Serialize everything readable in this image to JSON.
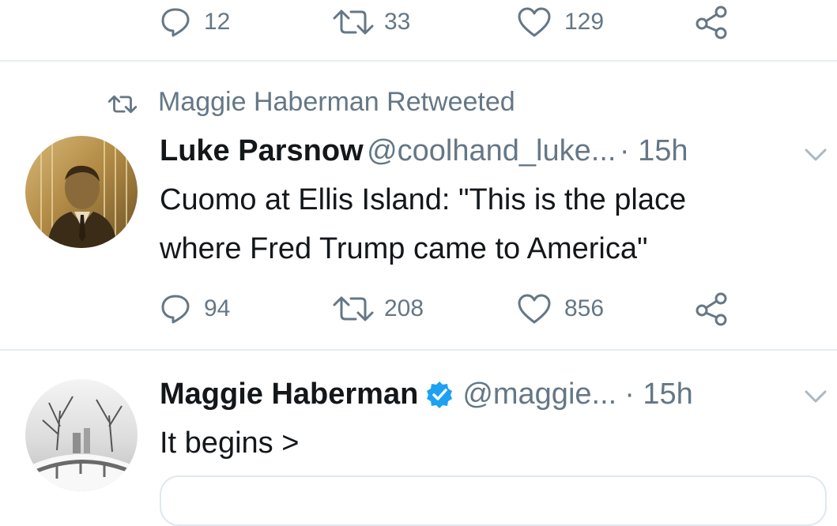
{
  "top_tweet": {
    "actions": {
      "replies": "12",
      "retweets": "33",
      "likes": "129"
    }
  },
  "retweet_header": {
    "label": "Maggie Haberman Retweeted"
  },
  "tweet1": {
    "name": "Luke Parsnow",
    "handle": "@coolhand_luke...",
    "time": "· 15h",
    "text_line1": "Cuomo at Ellis Island: \"This is the place",
    "text_line2": "where Fred Trump came to America\"",
    "actions": {
      "replies": "94",
      "retweets": "208",
      "likes": "856"
    }
  },
  "tweet2": {
    "name": "Maggie Haberman",
    "handle": "@maggie...",
    "time": "· 15h",
    "text": "It begins >"
  },
  "colors": {
    "accent": "#1da1f2",
    "muted": "#657786",
    "text": "#14171a",
    "divider": "#e6ecf0"
  },
  "icons": [
    "reply-icon",
    "retweet-icon",
    "like-icon",
    "share-icon",
    "chevron-down-icon",
    "verified-badge-icon"
  ]
}
